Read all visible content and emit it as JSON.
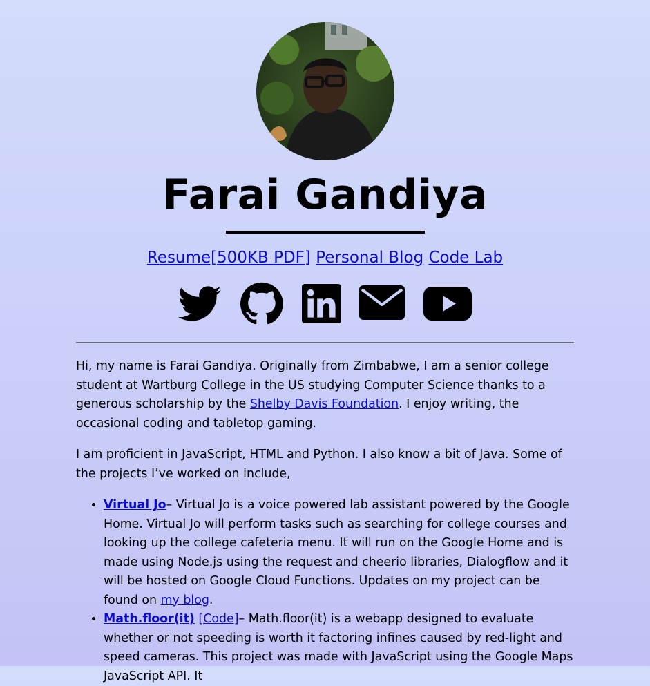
{
  "profile": {
    "name": "Farai Gandiya"
  },
  "nav": {
    "resume": "Resume[500KB PDF]",
    "blog": "Personal Blog",
    "codelab": "Code Lab"
  },
  "social": [
    {
      "icon": "twitter-icon"
    },
    {
      "icon": "github-icon"
    },
    {
      "icon": "linkedin-icon"
    },
    {
      "icon": "email-icon"
    },
    {
      "icon": "youtube-icon"
    }
  ],
  "intro": {
    "part1": "Hi, my name is Farai Gandiya. Originally from Zimbabwe, I am a senior college student at Wartburg College in the US studying Computer Science thanks to a generous scholarship by the ",
    "link": "Shelby Davis Foundation",
    "part2": ". I enjoy writing, the occasional coding and tabletop gaming."
  },
  "skills": {
    "text": "I am proficient in JavaScript, HTML and Python. I also know a bit of Java. Some of the projects I’ve worked on include,"
  },
  "projects": [
    {
      "title": "Virtual Jo",
      "text": "– Virtual Jo is a voice powered lab assistant powered by the Google Home. Virtual Jo will perform tasks such as searching for college courses and looking up the college cafeteria menu. It will run on the Google Home and is made using Node.js using the request and cheerio libraries, Dialogflow and it will be hosted on Google Cloud Functions. Updates on my project can be found on ",
      "link": "my blog",
      "end": "."
    },
    {
      "title": "Math.floor(it)",
      "code": "[Code]",
      "text": "– Math.floor(it) is a webapp designed to evaluate whether or not speeding is worth it factoring infines caused by red-light and speed cameras. This project was made with JavaScript using the Google Maps JavaScript API. It"
    }
  ]
}
